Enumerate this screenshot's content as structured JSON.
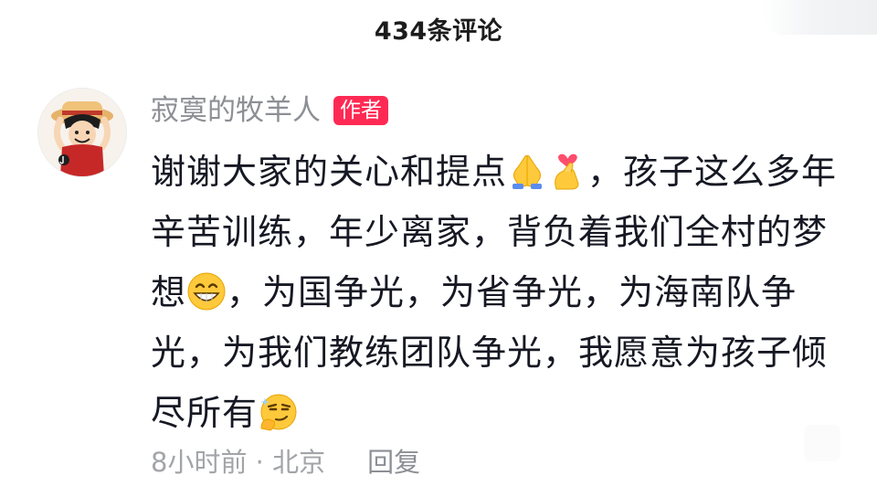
{
  "header": {
    "comment_count_title": "434条评论"
  },
  "comment": {
    "username": "寂寞的牧羊人",
    "author_badge": "作者",
    "text_segments": {
      "s1": "谢谢大家的关心和提点",
      "s2": "，孩子这么多年辛苦训练，年少离家，背负着我们全村的梦想",
      "s3": "，为国争光，为省争光，为海南队争光，为我们教练团队争光，我愿意为孩子倾尽所有"
    },
    "emoji_icons": [
      "praying-hands-icon",
      "finger-heart-icon",
      "grinning-face-icon",
      "smirking-face-icon"
    ],
    "time_location": "8小时前 · 北京",
    "reply_label": "回复"
  },
  "colors": {
    "badge": "#ff2a54",
    "username": "#8d8f95",
    "text": "#161823",
    "meta": "#a2a4a8"
  }
}
